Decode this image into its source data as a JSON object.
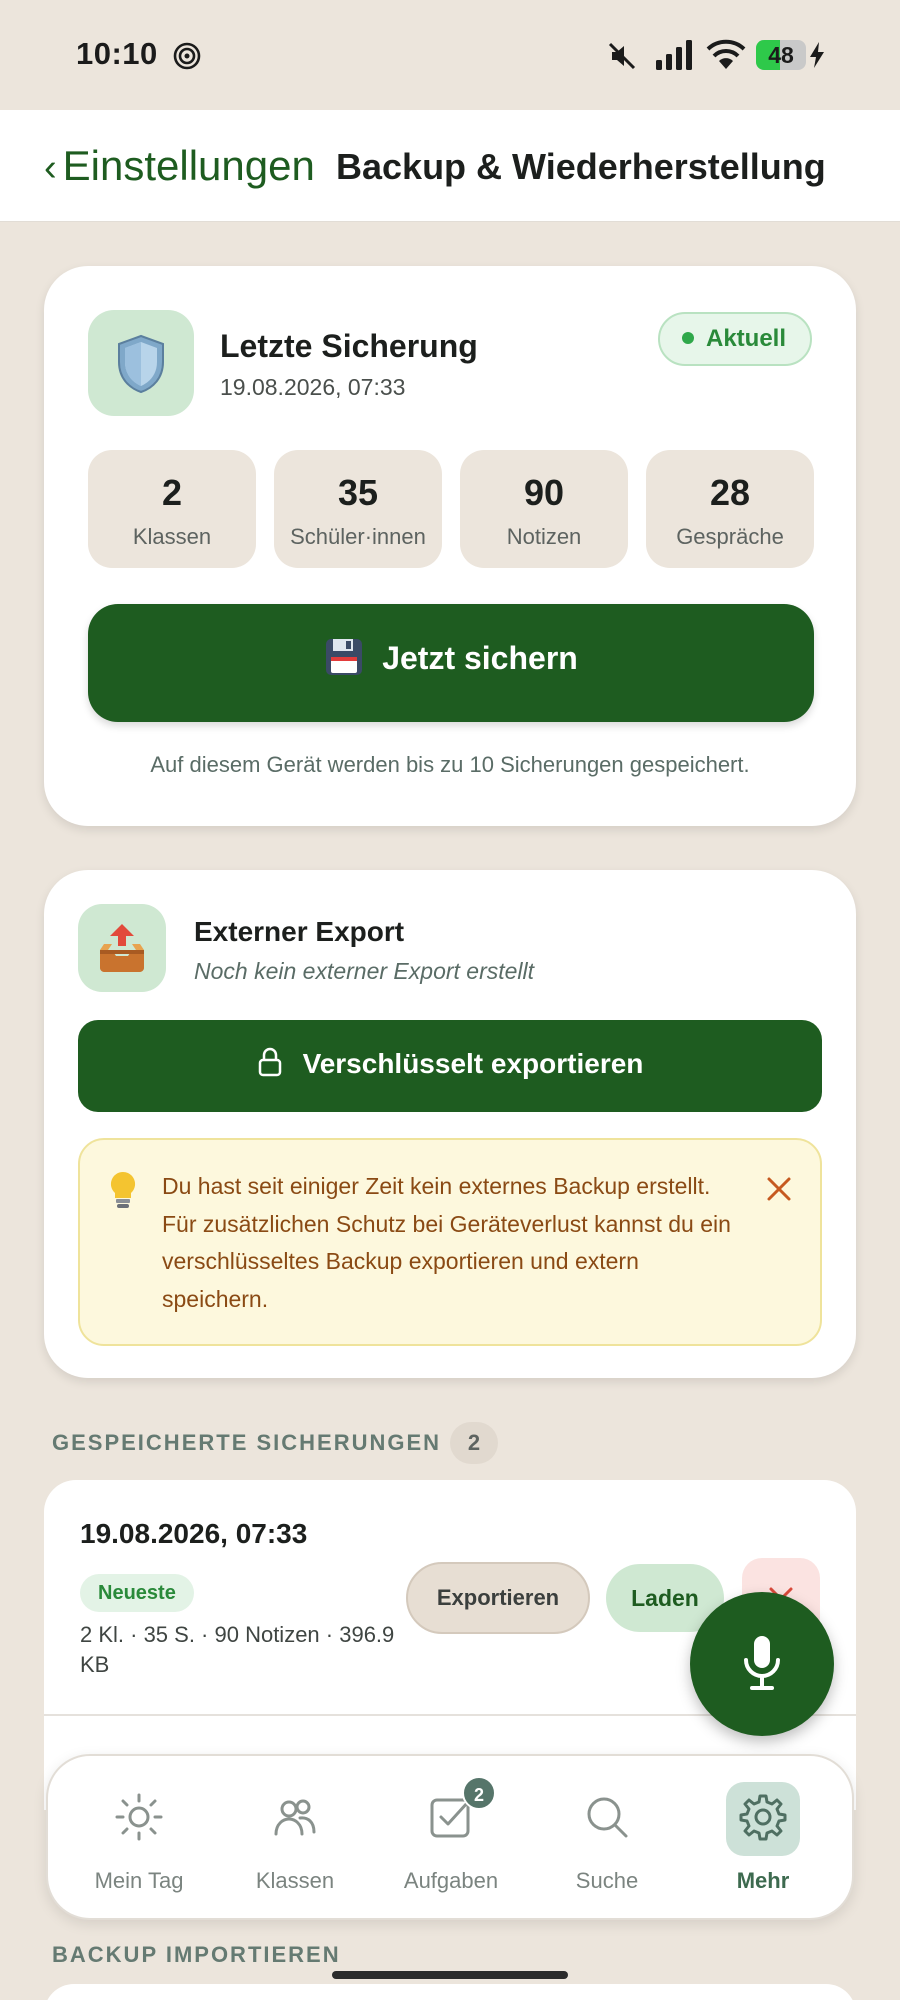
{
  "status_bar": {
    "time": "10:10",
    "battery_level": "48",
    "battery_fraction": 0.48
  },
  "header": {
    "back_label": "Einstellungen",
    "back_chevron": "‹",
    "title": "Backup & Wiederherstellung"
  },
  "last_backup": {
    "icon": "shield-icon",
    "title": "Letzte Sicherung",
    "date": "19.08.2026, 07:33",
    "status_badge": "Aktuell",
    "stats": [
      {
        "value": "2",
        "label": "Klassen"
      },
      {
        "value": "35",
        "label": "Schüler·innen"
      },
      {
        "value": "90",
        "label": "Notizen"
      },
      {
        "value": "28",
        "label": "Gespräche"
      }
    ],
    "save_button": "Jetzt sichern",
    "note": "Auf diesem Gerät werden bis zu 10 Sicherungen gespeichert."
  },
  "external_export": {
    "icon": "outbox-tray-icon",
    "title": "Externer Export",
    "subtitle": "Noch kein externer Export erstellt",
    "export_button": "Verschlüsselt exportieren",
    "hint": "Du hast seit einiger Zeit kein externes Backup erstellt. Für zusätzlichen Schutz bei Geräteverlust kannst du ein verschlüsseltes Backup exportieren und extern speichern."
  },
  "saved_backups": {
    "section_title": "GESPEICHERTE SICHERUNGEN",
    "count": "2",
    "items": [
      {
        "date": "19.08.2026, 07:33",
        "badge": "Neueste",
        "meta": "2 Kl. · 35 S. · 90 Notizen · 396.9 KB",
        "export_label": "Exportieren",
        "load_label": "Laden"
      }
    ]
  },
  "import_section": {
    "section_title": "BACKUP IMPORTIEREN"
  },
  "bottom_nav": {
    "items": [
      {
        "label": "Mein Tag",
        "icon": "sun-icon"
      },
      {
        "label": "Klassen",
        "icon": "people-icon"
      },
      {
        "label": "Aufgaben",
        "icon": "checkbox-icon",
        "badge": "2"
      },
      {
        "label": "Suche",
        "icon": "search-icon"
      },
      {
        "label": "Mehr",
        "icon": "gear-icon",
        "active": true
      }
    ]
  },
  "colors": {
    "brand_green": "#1e5c20",
    "background": "#ece5dc",
    "success_green": "#2a8a3a",
    "warning_text": "#8a4a14",
    "warning_bg": "#fdf8dd"
  }
}
